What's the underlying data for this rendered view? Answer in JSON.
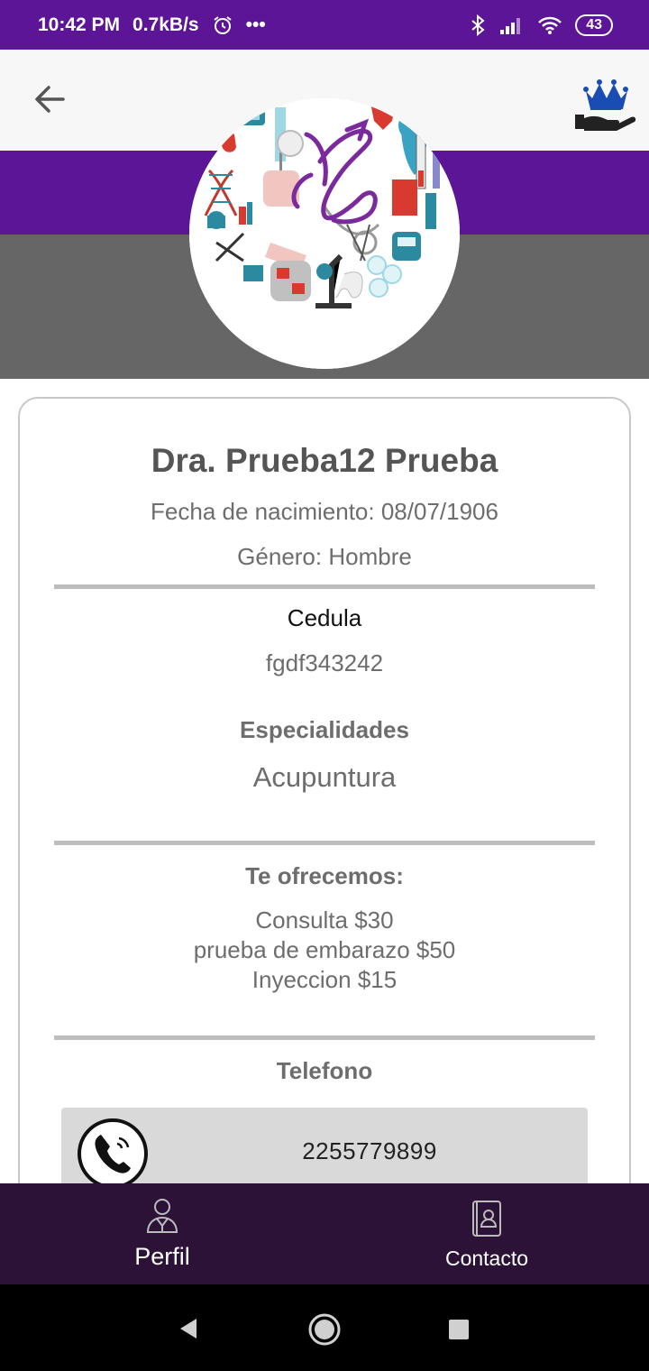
{
  "status_bar": {
    "time": "10:42 PM",
    "net_speed": "0.7kB/s",
    "more": "•••",
    "battery": "43",
    "icons": [
      "alarm-icon",
      "bluetooth-icon",
      "signal-icon",
      "wifi-icon",
      "battery-icon"
    ]
  },
  "app_bar": {
    "back_icon": "arrow-back-icon",
    "premium_icon": "crown-hand-icon"
  },
  "colors": {
    "primary": "#5c1596",
    "nav_dark": "#2d1238",
    "hero_gray": "#666666"
  },
  "profile": {
    "name": "Dra. Prueba12 Prueba",
    "birth": "Fecha de nacimiento: 08/07/1906",
    "gender": "Género: Hombre",
    "cedula_label": "Cedula",
    "cedula_value": "fgdf343242",
    "specialties_label": "Especialidades",
    "specialty": "Acupuntura",
    "offers_label": "Te ofrecemos:",
    "offers": [
      "Consulta $30",
      "prueba de embarazo $50",
      "Inyeccion $15"
    ],
    "phone_label": "Telefono",
    "phone": "2255779899"
  },
  "bottom_nav": {
    "items": [
      {
        "label": "Perfil",
        "icon": "doctor-icon"
      },
      {
        "label": "Contacto",
        "icon": "contact-book-icon"
      }
    ]
  },
  "system_nav": [
    "back-triangle-icon",
    "home-circle-icon",
    "recents-square-icon"
  ]
}
